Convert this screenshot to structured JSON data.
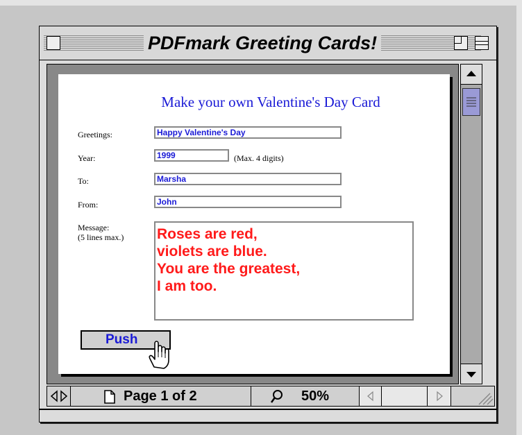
{
  "window": {
    "title": "PDFmark Greeting Cards!"
  },
  "form": {
    "heading": "Make your own Valentine's Day Card",
    "greetings": {
      "label": "Greetings:",
      "value": "Happy Valentine's Day"
    },
    "year": {
      "label": "Year:",
      "value": "1999",
      "hint": "(Max. 4 digits)"
    },
    "to": {
      "label": "To:",
      "value": "Marsha"
    },
    "from": {
      "label": "From:",
      "value": "John"
    },
    "message": {
      "label": "Message:",
      "sublabel": "(5 lines max.)",
      "value": "Roses are red,\nviolets are blue.\nYou are the greatest,\nI am too."
    },
    "push_label": "Push"
  },
  "statusbar": {
    "page_label": "Page 1 of 2",
    "zoom_label": "50%"
  },
  "colors": {
    "field_text": "#1a1ad6",
    "message_text": "#ff1a1a",
    "scroll_thumb": "#9a9ad6"
  }
}
